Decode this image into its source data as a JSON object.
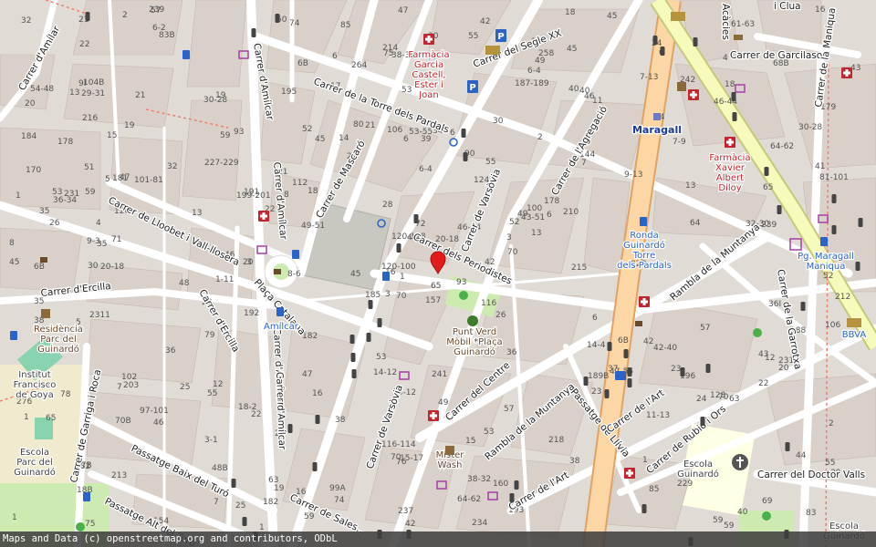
{
  "map": {
    "streets": [
      {
        "id": "carrer-de-garcilaso",
        "text": "Carrer de Garcilaso"
      },
      {
        "id": "carrer-de-la-torre-dels-pardals",
        "text": "Carrer de la Torre dels Pardals"
      },
      {
        "id": "carrer-del-segle-xx",
        "text": "Carrer del Segle XX"
      },
      {
        "id": "carrer-de-mascaro",
        "text": "Carrer de Mascaró"
      },
      {
        "id": "carrer-damilcar-1",
        "text": "Carrer d'Amílcar"
      },
      {
        "id": "carrer-damilcar-2",
        "text": "Carrer d'Amílcar"
      },
      {
        "id": "carrer-damilcar-3",
        "text": "Carrer d'Amílcar"
      },
      {
        "id": "carrer-damilcar-4",
        "text": "Carrer d'Amílcar"
      },
      {
        "id": "carrer-de-lagregacio",
        "text": "Carrer de l'Agregació"
      },
      {
        "id": "carrer-de-varsovia-1",
        "text": "Carrer de Varsòvia"
      },
      {
        "id": "carrer-de-varsovia-2",
        "text": "Carrer de Varsòvia"
      },
      {
        "id": "carrer-dels-periodistes",
        "text": "Carrer dels Periodistes"
      },
      {
        "id": "carrer-de-lliobet",
        "text": "Carrer de Lloobet i Vall-llosera"
      },
      {
        "id": "carrer-dercilla-1",
        "text": "Carrer d'Ercilla"
      },
      {
        "id": "carrer-dercilla-2",
        "text": "Carrer d'Ercilla"
      },
      {
        "id": "placa-catalana",
        "text": "Plaça Catalana"
      },
      {
        "id": "carrer-de-garriga-i-roca",
        "text": "Carrer de Garriga i Roca"
      },
      {
        "id": "passatge-baix-del-turo",
        "text": "Passatge Baix del Turó"
      },
      {
        "id": "passatge-alt-del-turo",
        "text": "Passatge Alt del Turó"
      },
      {
        "id": "carrer-de-sales",
        "text": "Carrer de Sales..."
      },
      {
        "id": "carrer-del-centre",
        "text": "Carrer del Centre"
      },
      {
        "id": "rambla-de-la-muntanya-1",
        "text": "Rambla de la Muntanya"
      },
      {
        "id": "rambla-de-la-muntanya-2",
        "text": "Rambla de la Muntanya"
      },
      {
        "id": "passatge-de-llivia",
        "text": "Passatge de Llívia"
      },
      {
        "id": "carrer-de-lart-1",
        "text": "Carrer de l'Art"
      },
      {
        "id": "carrer-de-lart-2",
        "text": "Carrer de l'Art"
      },
      {
        "id": "carrer-de-rubio-i-ors",
        "text": "Carrer de Rubió i Ors"
      },
      {
        "id": "carrer-del-doctor-valls",
        "text": "Carrer del Doctor Valls"
      },
      {
        "id": "carrer-de-la-garrotxa",
        "text": "Carrer de la Garrotxa"
      },
      {
        "id": "carrer-de-la-maniqua",
        "text": "Carrer de la Maniqua"
      },
      {
        "id": "carrer-dambar",
        "text": "Carrer d'Amílar"
      },
      {
        "id": "acacies",
        "text": "Acàcies"
      },
      {
        "id": "i-clua",
        "text": "i Clua"
      }
    ],
    "pois": [
      {
        "id": "farmacia-garcia",
        "lines": [
          "Farmàcia",
          "Garcia",
          "Castell,",
          "Ester i",
          "Joan"
        ]
      },
      {
        "id": "farmacia-xavier",
        "lines": [
          "Farmàcia",
          "Xavier",
          "Albert",
          "Diloy"
        ]
      },
      {
        "id": "maragall",
        "lines": [
          "Maragall"
        ]
      },
      {
        "id": "ronda-guinardo",
        "lines": [
          "Ronda",
          "Guinardó",
          "Torre",
          "dels Pardals"
        ]
      },
      {
        "id": "pg-maragall",
        "lines": [
          "Pg. Maragall",
          "Maniqua"
        ]
      },
      {
        "id": "amilcar",
        "lines": [
          "Amílcar"
        ]
      },
      {
        "id": "residencia",
        "lines": [
          "Residència",
          "Parc del",
          "Guinardó"
        ]
      },
      {
        "id": "institut",
        "lines": [
          "Institut",
          "Francisco",
          "de Goya"
        ]
      },
      {
        "id": "escola-parc",
        "lines": [
          "Escola",
          "Parc del",
          "Guinardó"
        ]
      },
      {
        "id": "punt-verd",
        "lines": [
          "Punt Verd",
          "Mòbil *Plaça",
          "Guinardó"
        ]
      },
      {
        "id": "mister-wash",
        "lines": [
          "Mister",
          "Wash"
        ]
      },
      {
        "id": "escola-guinardo",
        "lines": [
          "Escola",
          "Guinardó"
        ]
      },
      {
        "id": "bbva",
        "lines": [
          "BBVA"
        ]
      },
      {
        "id": "escola-bottom",
        "lines": [
          "Escola",
          "Guinardó"
        ]
      }
    ],
    "house_numbers": [
      "157",
      "15",
      "16",
      "77B",
      "52",
      "22",
      "45",
      "34",
      "40",
      "42",
      "83B",
      "83",
      "71",
      "179",
      "185",
      "144",
      "154",
      "106",
      "124",
      "97-101",
      "18",
      "18B",
      "48B",
      "53-55",
      "43-51",
      "42-40",
      "19",
      "38-32",
      "26",
      "14-4",
      "81-101",
      "120-100",
      "116-114",
      "120-118",
      "93",
      "7-13",
      "18-2",
      "40",
      "44",
      "42",
      "42",
      "8",
      "13",
      "23",
      "25",
      "1",
      "3",
      "75",
      "76",
      "70",
      "70B",
      "64-62",
      "54-48",
      "47-55",
      "38",
      "3-1",
      "6-2",
      "21",
      "15",
      "18",
      "20",
      "3",
      "231",
      "227-229",
      "242",
      "239",
      "258",
      "264",
      "72",
      "276",
      "14-12",
      "16",
      "6B",
      "199-201",
      "182",
      "22",
      "32",
      "38",
      "28",
      "38-32",
      "46-44",
      "213",
      "215",
      "231",
      "237",
      "239",
      "241",
      "229",
      "234",
      "218",
      "214",
      "212",
      "210",
      "11-13",
      "20-18",
      "22",
      "36-34",
      "42",
      "40",
      "46",
      "48",
      "50",
      "52",
      "35",
      "36",
      "55",
      "63",
      "49",
      "46-44",
      "49-51",
      "36I",
      "29-31",
      "39",
      "45",
      "74",
      "78",
      "70",
      "68B",
      "80",
      "85",
      "7",
      "61-63",
      "90",
      "52",
      "82B",
      "79",
      "69",
      "74",
      "64",
      "216",
      "203",
      "193",
      "191",
      "195",
      "188",
      "196",
      "192",
      "102",
      "106",
      "112",
      "116",
      "120",
      "128",
      "93",
      "100",
      "104B",
      "99A",
      "85",
      "70",
      "75",
      "65",
      "59",
      "53",
      "59",
      "57",
      "55",
      "53",
      "6-4",
      "1-11",
      "30",
      "36",
      "44",
      "45",
      "47",
      "49",
      "51",
      "53",
      "55",
      "57",
      "59",
      "63",
      "160",
      "170",
      "174",
      "178",
      "182",
      "187-189",
      "189B",
      "184",
      "181",
      "178",
      "65",
      "64-62",
      "59",
      "9I",
      "101-81",
      "5",
      "4",
      "2",
      "1",
      "12",
      "16",
      "6",
      "7-9",
      "13",
      "15-17",
      "20-18",
      "21",
      "23",
      "25",
      "35",
      "24",
      "22",
      "8",
      "9-13",
      "6B",
      "3",
      "1",
      "14-12",
      "6",
      "2",
      "30-28",
      "22",
      "20",
      "32-30",
      "38",
      "46",
      "26",
      "182",
      "9-3",
      "6",
      "6",
      "1",
      "2",
      "7",
      "12",
      "6",
      "4",
      "2",
      "1",
      "18",
      "20",
      "1",
      "32",
      "28",
      "6-4",
      "46",
      "30",
      "35",
      "37",
      "41",
      "43",
      "45",
      "47",
      "49",
      "57",
      "39",
      "30-28",
      "7",
      "13",
      "14",
      "19",
      "16",
      "21",
      "59",
      "64",
      "47",
      "53",
      "55",
      "24",
      "70",
      "6",
      "65",
      "43",
      "44",
      "17",
      "45",
      "19",
      "21",
      "20",
      "6B",
      "11",
      "13",
      "2311",
      "8-6",
      "5"
    ],
    "attribution": "Maps and Data (c) openstreetmap.org and contributors, ODbL",
    "colors": {
      "background": "#e0dbd5",
      "building": "#d9d0c9",
      "building_stroke": "#c4b8ae",
      "road": "#ffffff",
      "primary": "#fcd6a4",
      "primary_stroke": "#e0a365",
      "trunk": "#f6fabb",
      "trunk_stroke": "#c6c87a",
      "park": "#c8f0c8",
      "school": "#ffffe5",
      "pitch": "#aae0cb",
      "pharmacy_red": "#c2252d",
      "metro_blue": "#2b63c6"
    }
  }
}
